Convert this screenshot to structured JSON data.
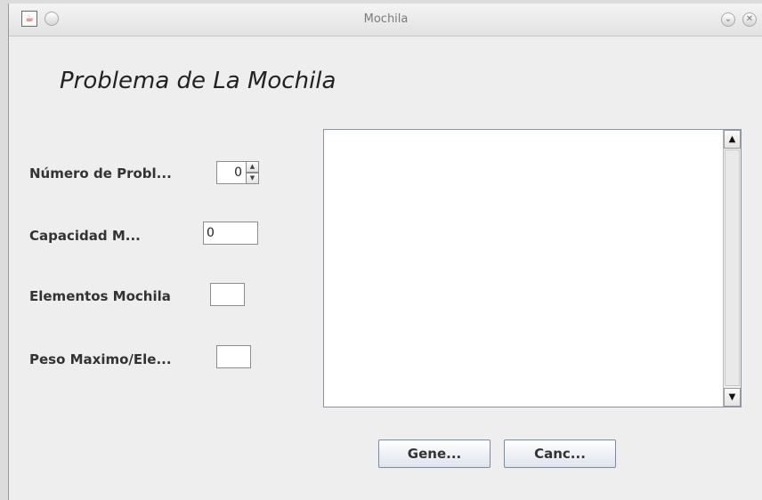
{
  "window": {
    "title": "Mochila",
    "icon": "java-icon",
    "controls": [
      "minimize-icon",
      "close-icon"
    ]
  },
  "heading": "Problema de La Mochila",
  "form": {
    "numero_label": "Número de Probl...",
    "numero_value": "0",
    "capacidad_label": "Capacidad M...",
    "capacidad_value": "0",
    "elementos_label": "Elementos Mochila",
    "elementos_value": "",
    "peso_label": "Peso Maximo/Ele...",
    "peso_value": ""
  },
  "output": {
    "text": ""
  },
  "buttons": {
    "generate": "Gene...",
    "cancel": "Canc..."
  },
  "colors": {
    "background": "#eeeeee",
    "button_border": "#7a8aa6"
  }
}
